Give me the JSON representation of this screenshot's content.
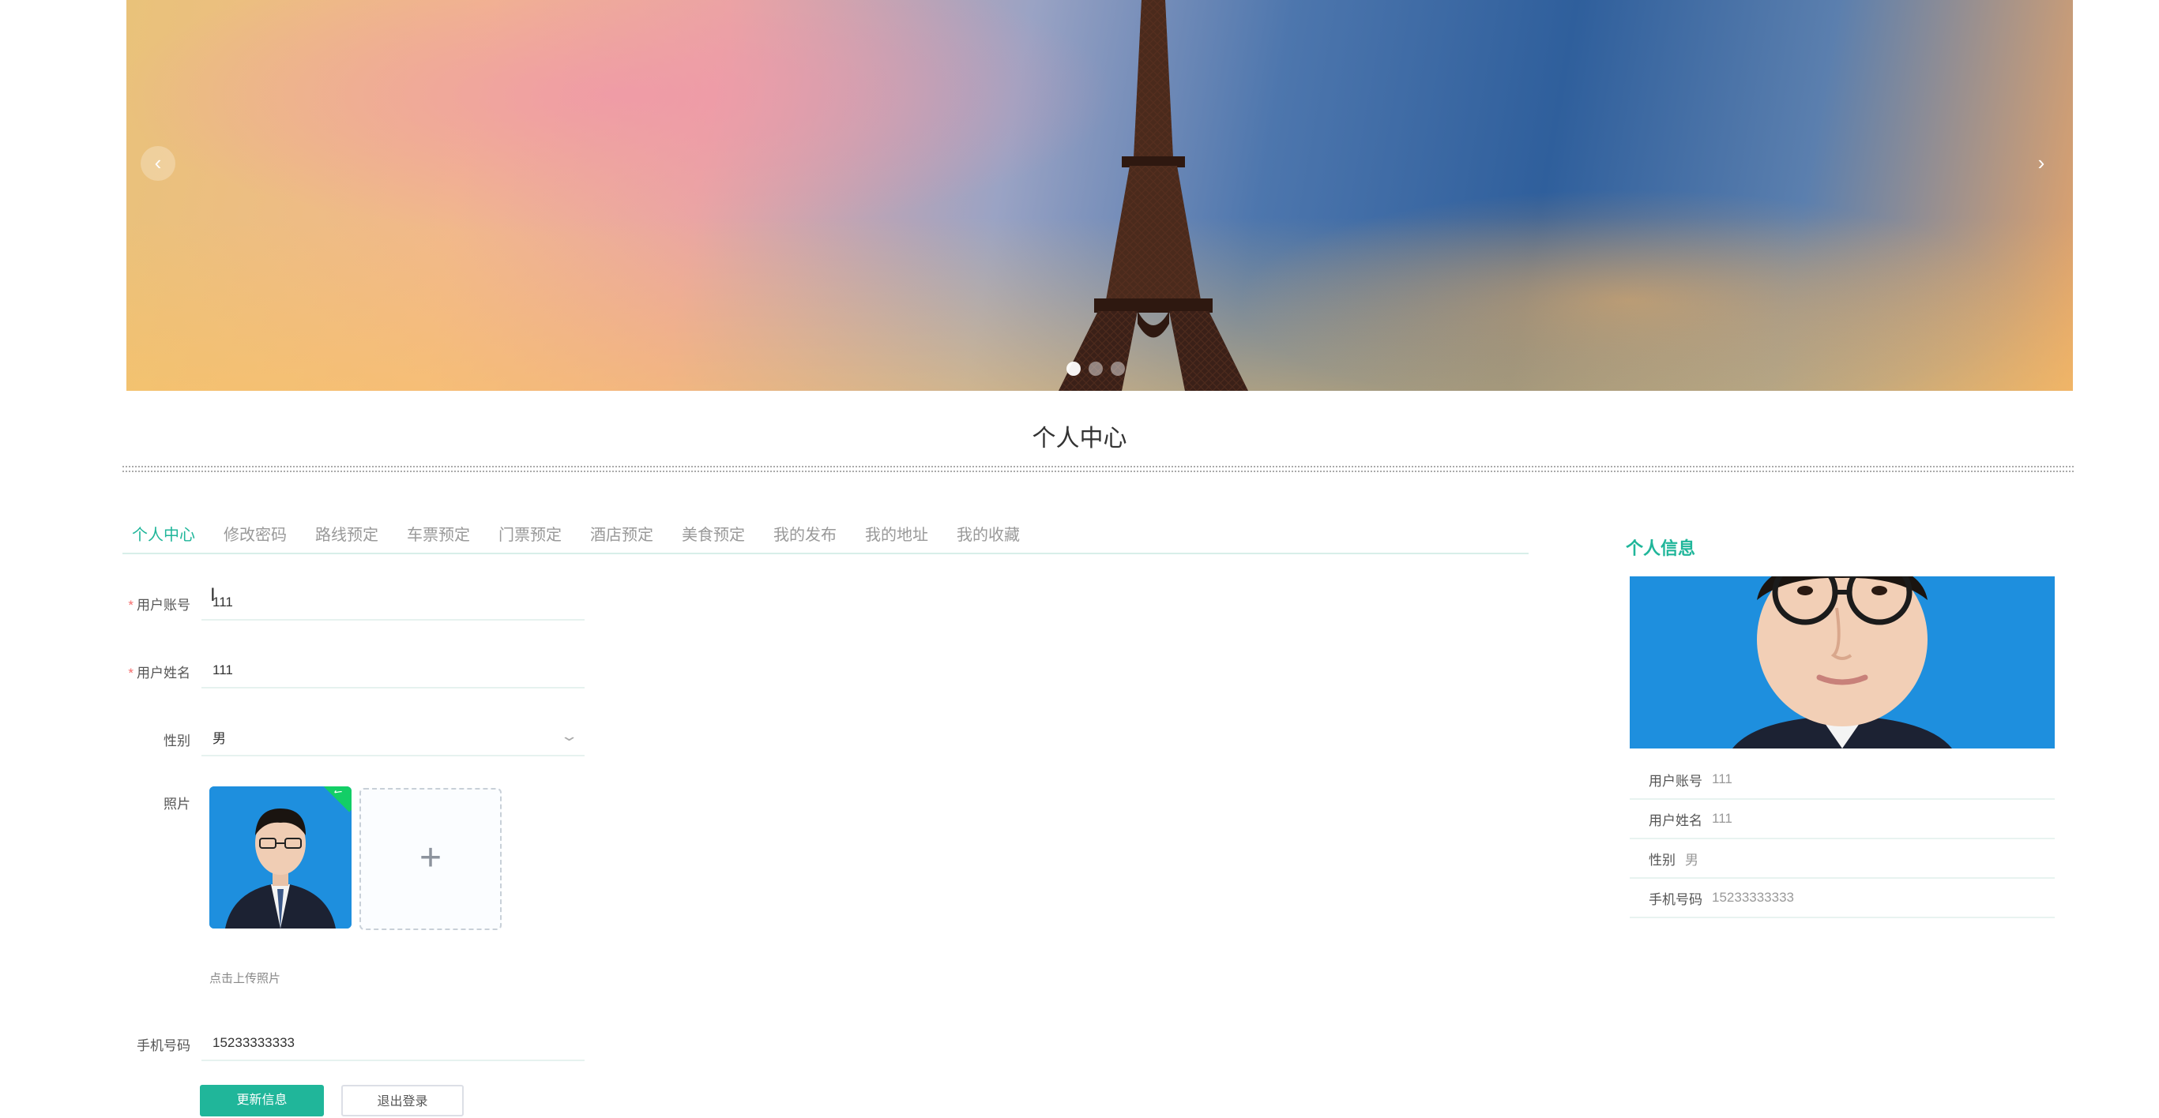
{
  "carousel": {
    "prev_icon": "‹",
    "next_icon": "›",
    "slide_count": 3,
    "active_index": 0
  },
  "page": {
    "title": "个人中心"
  },
  "tabs": [
    {
      "label": "个人中心",
      "active": true
    },
    {
      "label": "修改密码",
      "active": false
    },
    {
      "label": "路线预定",
      "active": false
    },
    {
      "label": "车票预定",
      "active": false
    },
    {
      "label": "门票预定",
      "active": false
    },
    {
      "label": "酒店预定",
      "active": false
    },
    {
      "label": "美食预定",
      "active": false
    },
    {
      "label": "我的发布",
      "active": false
    },
    {
      "label": "我的地址",
      "active": false
    },
    {
      "label": "我的收藏",
      "active": false
    }
  ],
  "form": {
    "required_mark": "*",
    "account": {
      "label": "用户账号",
      "value": "111"
    },
    "name": {
      "label": "用户姓名",
      "value": "111"
    },
    "gender": {
      "label": "性别",
      "value": "男"
    },
    "photo": {
      "label": "照片",
      "upload_tip": "点击上传照片",
      "plus": "+",
      "check": "✓"
    },
    "phone": {
      "label": "手机号码",
      "value": "15233333333"
    },
    "buttons": {
      "primary": "更新信息",
      "secondary": "退出登录"
    }
  },
  "profile_card": {
    "title": "个人信息",
    "rows": [
      {
        "label": "用户账号",
        "value": "111"
      },
      {
        "label": "用户姓名",
        "value": "111"
      },
      {
        "label": "性别",
        "value": "男"
      },
      {
        "label": "手机号码",
        "value": "15233333333"
      }
    ]
  },
  "colors": {
    "accent": "#20b69a",
    "required": "#f56c6c",
    "photo_bg": "#1e8fde",
    "success": "#13ce66"
  },
  "icons": {
    "chevron": "chevron-down-icon",
    "upload": "plus-icon",
    "check": "check-icon"
  }
}
